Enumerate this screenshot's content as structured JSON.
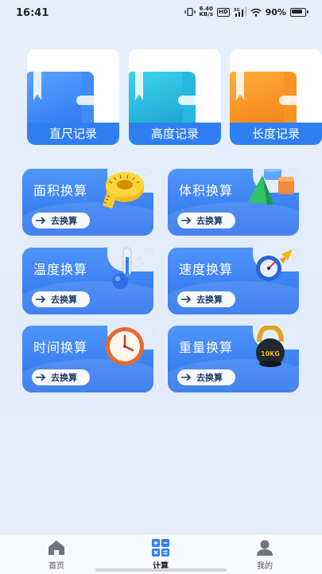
{
  "status_bar": {
    "time": "16:41",
    "net_speed_top": "6.40",
    "net_speed_bottom": "KB/s",
    "hd_label": "HD",
    "network": "5G",
    "battery_pct": "90%"
  },
  "records": [
    {
      "label": "直尺记录",
      "color": "#2f7ff3",
      "icon": "blue-book-icon"
    },
    {
      "label": "高度记录",
      "color": "#19b6d8",
      "icon": "teal-book-icon"
    },
    {
      "label": "长度记录",
      "color": "#f48a17",
      "icon": "orange-book-icon"
    }
  ],
  "conversions": [
    {
      "title": "面积换算",
      "button": "去换算",
      "icon": "tape-measure-icon"
    },
    {
      "title": "体积换算",
      "button": "去换算",
      "icon": "3d-shapes-icon"
    },
    {
      "title": "温度换算",
      "button": "去换算",
      "icon": "thermometer-icon"
    },
    {
      "title": "速度换算",
      "button": "去换算",
      "icon": "speed-rocket-icon"
    },
    {
      "title": "时间换算",
      "button": "去换算",
      "icon": "clock-icon"
    },
    {
      "title": "重量换算",
      "button": "去换算",
      "icon": "kettlebell-icon"
    }
  ],
  "kettlebell_text": "10KG",
  "tabbar": {
    "items": [
      {
        "label": "首页",
        "icon": "home-icon",
        "active": false
      },
      {
        "label": "计算",
        "icon": "calculator-icon",
        "active": true
      },
      {
        "label": "我的",
        "icon": "user-icon",
        "active": false
      }
    ]
  },
  "colors": {
    "primary": "#2f7ff3",
    "background": "#e6effc"
  }
}
